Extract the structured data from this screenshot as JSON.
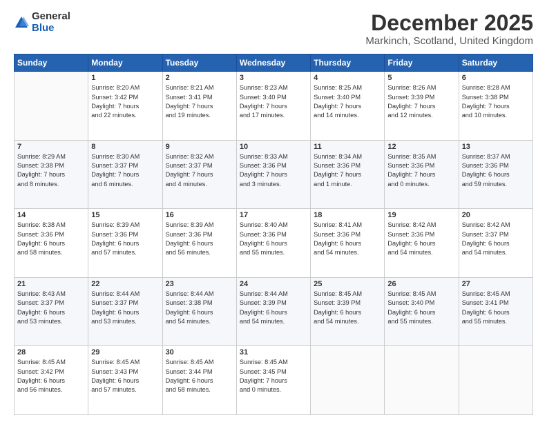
{
  "logo": {
    "general": "General",
    "blue": "Blue"
  },
  "title": "December 2025",
  "location": "Markinch, Scotland, United Kingdom",
  "weekdays": [
    "Sunday",
    "Monday",
    "Tuesday",
    "Wednesday",
    "Thursday",
    "Friday",
    "Saturday"
  ],
  "weeks": [
    [
      {
        "day": "",
        "info": ""
      },
      {
        "day": "1",
        "info": "Sunrise: 8:20 AM\nSunset: 3:42 PM\nDaylight: 7 hours\nand 22 minutes."
      },
      {
        "day": "2",
        "info": "Sunrise: 8:21 AM\nSunset: 3:41 PM\nDaylight: 7 hours\nand 19 minutes."
      },
      {
        "day": "3",
        "info": "Sunrise: 8:23 AM\nSunset: 3:40 PM\nDaylight: 7 hours\nand 17 minutes."
      },
      {
        "day": "4",
        "info": "Sunrise: 8:25 AM\nSunset: 3:40 PM\nDaylight: 7 hours\nand 14 minutes."
      },
      {
        "day": "5",
        "info": "Sunrise: 8:26 AM\nSunset: 3:39 PM\nDaylight: 7 hours\nand 12 minutes."
      },
      {
        "day": "6",
        "info": "Sunrise: 8:28 AM\nSunset: 3:38 PM\nDaylight: 7 hours\nand 10 minutes."
      }
    ],
    [
      {
        "day": "7",
        "info": "Sunrise: 8:29 AM\nSunset: 3:38 PM\nDaylight: 7 hours\nand 8 minutes."
      },
      {
        "day": "8",
        "info": "Sunrise: 8:30 AM\nSunset: 3:37 PM\nDaylight: 7 hours\nand 6 minutes."
      },
      {
        "day": "9",
        "info": "Sunrise: 8:32 AM\nSunset: 3:37 PM\nDaylight: 7 hours\nand 4 minutes."
      },
      {
        "day": "10",
        "info": "Sunrise: 8:33 AM\nSunset: 3:36 PM\nDaylight: 7 hours\nand 3 minutes."
      },
      {
        "day": "11",
        "info": "Sunrise: 8:34 AM\nSunset: 3:36 PM\nDaylight: 7 hours\nand 1 minute."
      },
      {
        "day": "12",
        "info": "Sunrise: 8:35 AM\nSunset: 3:36 PM\nDaylight: 7 hours\nand 0 minutes."
      },
      {
        "day": "13",
        "info": "Sunrise: 8:37 AM\nSunset: 3:36 PM\nDaylight: 6 hours\nand 59 minutes."
      }
    ],
    [
      {
        "day": "14",
        "info": "Sunrise: 8:38 AM\nSunset: 3:36 PM\nDaylight: 6 hours\nand 58 minutes."
      },
      {
        "day": "15",
        "info": "Sunrise: 8:39 AM\nSunset: 3:36 PM\nDaylight: 6 hours\nand 57 minutes."
      },
      {
        "day": "16",
        "info": "Sunrise: 8:39 AM\nSunset: 3:36 PM\nDaylight: 6 hours\nand 56 minutes."
      },
      {
        "day": "17",
        "info": "Sunrise: 8:40 AM\nSunset: 3:36 PM\nDaylight: 6 hours\nand 55 minutes."
      },
      {
        "day": "18",
        "info": "Sunrise: 8:41 AM\nSunset: 3:36 PM\nDaylight: 6 hours\nand 54 minutes."
      },
      {
        "day": "19",
        "info": "Sunrise: 8:42 AM\nSunset: 3:36 PM\nDaylight: 6 hours\nand 54 minutes."
      },
      {
        "day": "20",
        "info": "Sunrise: 8:42 AM\nSunset: 3:37 PM\nDaylight: 6 hours\nand 54 minutes."
      }
    ],
    [
      {
        "day": "21",
        "info": "Sunrise: 8:43 AM\nSunset: 3:37 PM\nDaylight: 6 hours\nand 53 minutes."
      },
      {
        "day": "22",
        "info": "Sunrise: 8:44 AM\nSunset: 3:37 PM\nDaylight: 6 hours\nand 53 minutes."
      },
      {
        "day": "23",
        "info": "Sunrise: 8:44 AM\nSunset: 3:38 PM\nDaylight: 6 hours\nand 54 minutes."
      },
      {
        "day": "24",
        "info": "Sunrise: 8:44 AM\nSunset: 3:39 PM\nDaylight: 6 hours\nand 54 minutes."
      },
      {
        "day": "25",
        "info": "Sunrise: 8:45 AM\nSunset: 3:39 PM\nDaylight: 6 hours\nand 54 minutes."
      },
      {
        "day": "26",
        "info": "Sunrise: 8:45 AM\nSunset: 3:40 PM\nDaylight: 6 hours\nand 55 minutes."
      },
      {
        "day": "27",
        "info": "Sunrise: 8:45 AM\nSunset: 3:41 PM\nDaylight: 6 hours\nand 55 minutes."
      }
    ],
    [
      {
        "day": "28",
        "info": "Sunrise: 8:45 AM\nSunset: 3:42 PM\nDaylight: 6 hours\nand 56 minutes."
      },
      {
        "day": "29",
        "info": "Sunrise: 8:45 AM\nSunset: 3:43 PM\nDaylight: 6 hours\nand 57 minutes."
      },
      {
        "day": "30",
        "info": "Sunrise: 8:45 AM\nSunset: 3:44 PM\nDaylight: 6 hours\nand 58 minutes."
      },
      {
        "day": "31",
        "info": "Sunrise: 8:45 AM\nSunset: 3:45 PM\nDaylight: 7 hours\nand 0 minutes."
      },
      {
        "day": "",
        "info": ""
      },
      {
        "day": "",
        "info": ""
      },
      {
        "day": "",
        "info": ""
      }
    ]
  ]
}
